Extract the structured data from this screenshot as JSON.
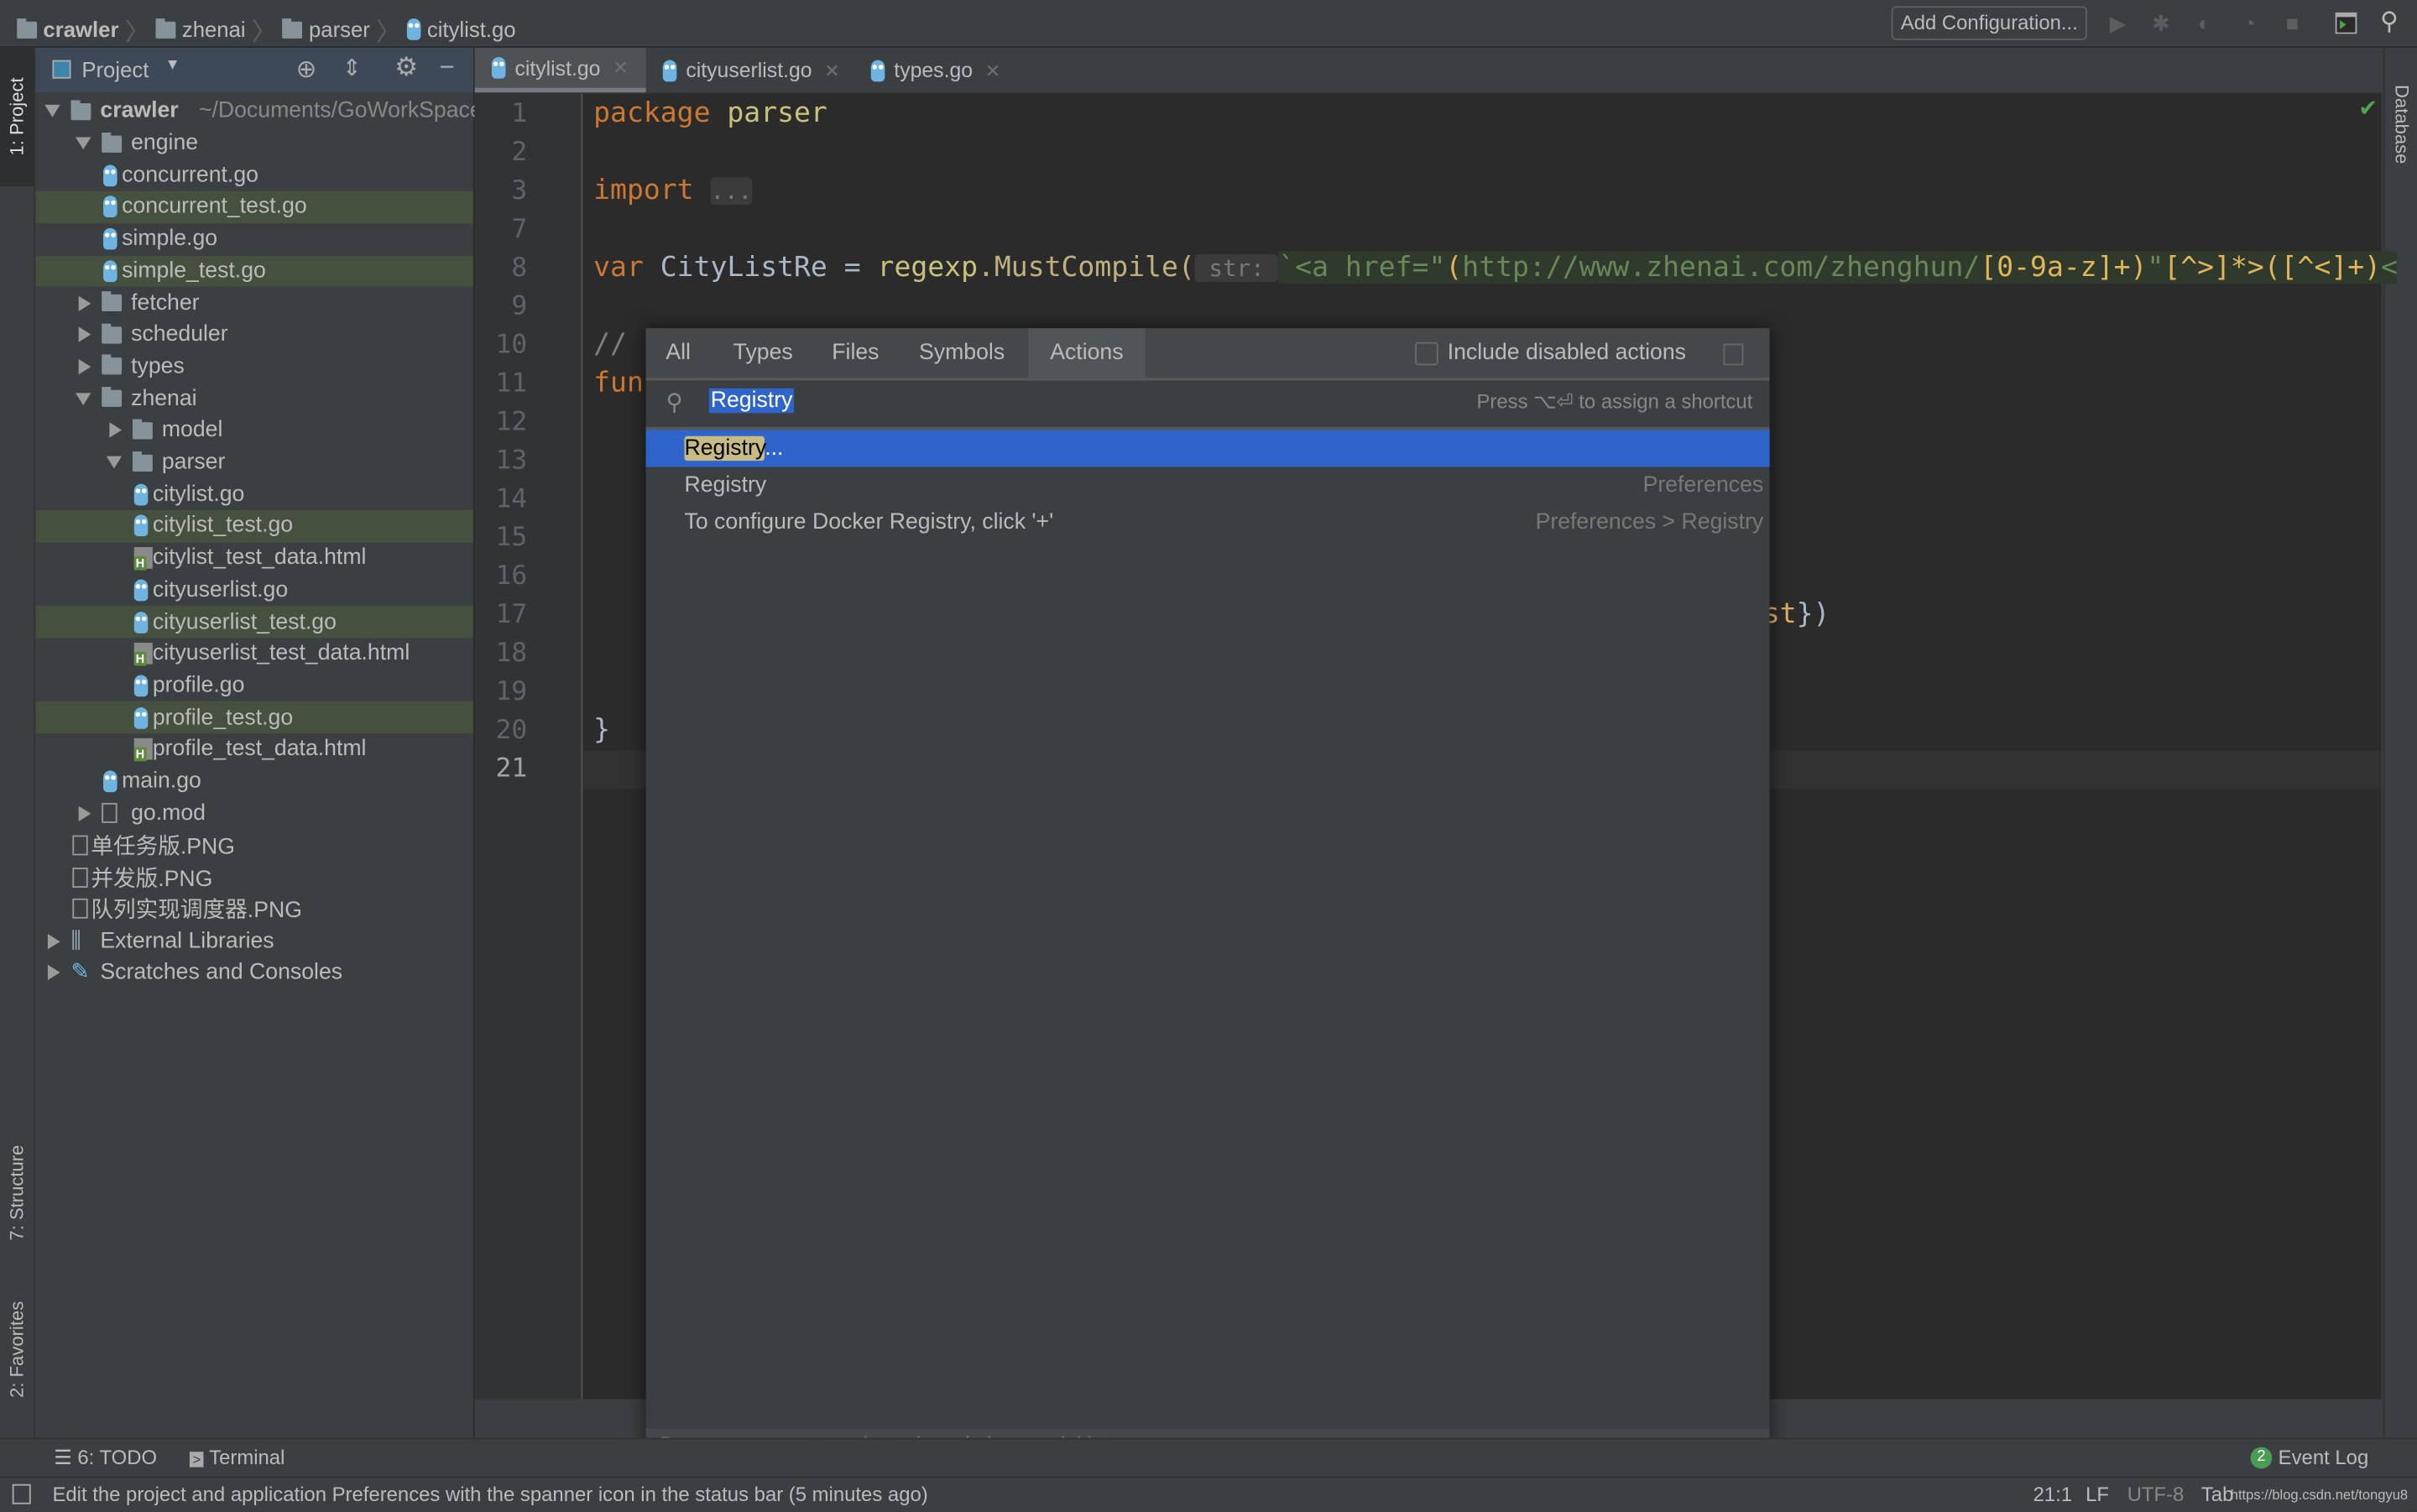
{
  "navbar": {
    "breadcrumbs": [
      "crawler",
      "zhenai",
      "parser",
      "citylist.go"
    ],
    "add_configuration": "Add Configuration...",
    "icons": [
      "run-icon",
      "debug-icon",
      "coverage-icon",
      "profile-icon",
      "stop-icon",
      "terminal-icon",
      "search-icon"
    ]
  },
  "left_strip": {
    "project": "1: Project",
    "structure": "7: Structure",
    "favorites": "2: Favorites"
  },
  "right_strip": {
    "database": "Database"
  },
  "project_panel": {
    "title": "Project",
    "tree": [
      {
        "label": "crawler",
        "suffix": "~/Documents/GoWorkSpace",
        "type": "folder",
        "level": 0,
        "open": true,
        "bold": true
      },
      {
        "label": "engine",
        "type": "folder",
        "level": 1,
        "open": true
      },
      {
        "label": "concurrent.go",
        "type": "go",
        "level": 2
      },
      {
        "label": "concurrent_test.go",
        "type": "go",
        "level": 2,
        "highlight": true
      },
      {
        "label": "simple.go",
        "type": "go",
        "level": 2
      },
      {
        "label": "simple_test.go",
        "type": "go",
        "level": 2,
        "highlight": true
      },
      {
        "label": "fetcher",
        "type": "folder",
        "level": 1,
        "open": false
      },
      {
        "label": "scheduler",
        "type": "folder",
        "level": 1,
        "open": false
      },
      {
        "label": "types",
        "type": "folder",
        "level": 1,
        "open": false
      },
      {
        "label": "zhenai",
        "type": "folder",
        "level": 1,
        "open": true
      },
      {
        "label": "model",
        "type": "folder",
        "level": 2,
        "open": false
      },
      {
        "label": "parser",
        "type": "folder",
        "level": 2,
        "open": true
      },
      {
        "label": "citylist.go",
        "type": "go",
        "level": 3
      },
      {
        "label": "citylist_test.go",
        "type": "go",
        "level": 3,
        "highlight": true
      },
      {
        "label": "citylist_test_data.html",
        "type": "html",
        "level": 3
      },
      {
        "label": "cityuserlist.go",
        "type": "go",
        "level": 3
      },
      {
        "label": "cityuserlist_test.go",
        "type": "go",
        "level": 3,
        "highlight": true
      },
      {
        "label": "cityuserlist_test_data.html",
        "type": "html",
        "level": 3
      },
      {
        "label": "profile.go",
        "type": "go",
        "level": 3
      },
      {
        "label": "profile_test.go",
        "type": "go",
        "level": 3,
        "highlight": true
      },
      {
        "label": "profile_test_data.html",
        "type": "html",
        "level": 3
      },
      {
        "label": "main.go",
        "type": "go",
        "level": 2
      },
      {
        "label": "go.mod",
        "type": "file",
        "level": 1,
        "open": false
      },
      {
        "label": "单任务版.PNG",
        "type": "file",
        "level": 1
      },
      {
        "label": "并发版.PNG",
        "type": "file",
        "level": 1
      },
      {
        "label": "队列实现调度器.PNG",
        "type": "file",
        "level": 1
      },
      {
        "label": "External Libraries",
        "type": "lib",
        "level": 0,
        "open": false
      },
      {
        "label": "Scratches and Consoles",
        "type": "scratch",
        "level": 0,
        "open": false
      }
    ]
  },
  "tabs": [
    {
      "label": "citylist.go",
      "active": true
    },
    {
      "label": "cityuserlist.go"
    },
    {
      "label": "types.go"
    }
  ],
  "editor": {
    "colors": {
      "keyword": "#cc7832",
      "ident": "#a9b7c6",
      "pkg": "#c8c27c",
      "func": "#c0b07e",
      "string": "#6a8759",
      "string_bg": "#2f3a2c",
      "regex": "#e3b55a",
      "hint": "#787878",
      "comment": "#808080",
      "field": "#e0b060"
    },
    "lines": [
      {
        "n": "1",
        "segs": [
          {
            "t": "package ",
            "c": "keyword"
          },
          {
            "t": "parser",
            "c": "pkg"
          }
        ]
      },
      {
        "n": "2",
        "segs": []
      },
      {
        "n": "3",
        "segs": [
          {
            "t": "import ",
            "c": "keyword"
          },
          {
            "t": "...",
            "c": "hint"
          }
        ]
      },
      {
        "n": "7",
        "segs": []
      },
      {
        "n": "8",
        "segs": [
          {
            "t": "var ",
            "c": "keyword"
          },
          {
            "t": "CityListRe = ",
            "c": "ident"
          },
          {
            "t": "regexp",
            "c": "pkg"
          },
          {
            "t": ".MustCompile(",
            "c": "func"
          },
          {
            "t": " str: ",
            "c": "hint"
          },
          {
            "t": "`<a href=\"",
            "c": "string"
          },
          {
            "t": "(",
            "c": "regex"
          },
          {
            "t": "http://www.zhenai.com/zhenghun/",
            "c": "string"
          },
          {
            "t": "[0-9a-z]+)",
            "c": "regex"
          },
          {
            "t": "\"",
            "c": "string"
          },
          {
            "t": "[^>]*>([^<]+)",
            "c": "regex"
          },
          {
            "t": "<",
            "c": "string"
          }
        ]
      },
      {
        "n": "9",
        "segs": []
      },
      {
        "n": "10",
        "segs": [
          {
            "t": "// ",
            "c": "comment"
          }
        ]
      },
      {
        "n": "11",
        "segs": [
          {
            "t": "func",
            "c": "keyword"
          }
        ]
      },
      {
        "n": "12",
        "segs": []
      },
      {
        "n": "13",
        "segs": []
      },
      {
        "n": "14",
        "segs": []
      },
      {
        "n": "15",
        "segs": []
      },
      {
        "n": "16",
        "segs": []
      },
      {
        "n": "17",
        "segs": [
          {
            "t": "ist",
            "c": "field",
            "offset": 69
          },
          {
            "t": "})",
            "c": "ident"
          }
        ]
      },
      {
        "n": "18",
        "segs": []
      },
      {
        "n": "19",
        "segs": []
      },
      {
        "n": "20",
        "segs": [
          {
            "t": "}",
            "c": "ident"
          }
        ]
      },
      {
        "n": "21",
        "segs": []
      }
    ]
  },
  "popup": {
    "tabs": [
      {
        "label": "All"
      },
      {
        "label": "Types"
      },
      {
        "label": "Files"
      },
      {
        "label": "Symbols"
      },
      {
        "label": "Actions",
        "active": true
      }
    ],
    "include_disabled": "Include disabled actions",
    "include_disabled_checked": false,
    "search_value": "Registry",
    "shortcut_hint": "Press ⌥⏎ to assign a shortcut",
    "results": [
      {
        "label_match": "Registry",
        "label_rest": "...",
        "right": "",
        "selected": true
      },
      {
        "label_match": "",
        "label_rest": "Registry",
        "right": "Preferences"
      },
      {
        "label_match": "",
        "label_rest": "To configure Docker Registry, click '+'",
        "right": "Preferences > Registry"
      }
    ],
    "footer": "Press ⌥↑ or ⌥↓ to navigate through the search history"
  },
  "bottom_bar": {
    "todo": "6: TODO",
    "terminal": "Terminal",
    "event_log_count": "2",
    "event_log": "Event Log"
  },
  "status_bar": {
    "message": "Edit the project and application Preferences with the spanner icon in the status bar (5 minutes ago)",
    "position": "21:1",
    "line_sep": "LF",
    "encoding": "UTF-8",
    "indent": "Tab",
    "watermark": "https://blog.csdn.net/tongyu8"
  }
}
